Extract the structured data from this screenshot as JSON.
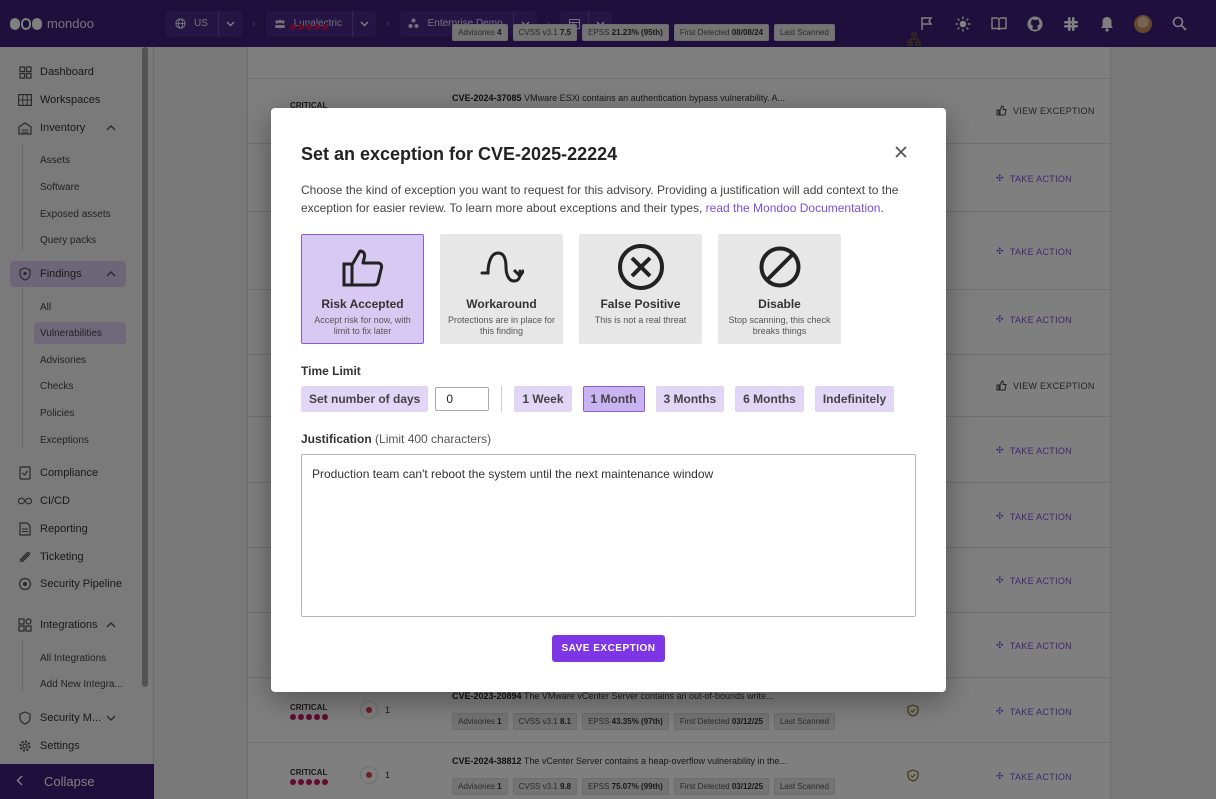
{
  "brand": {
    "name": "mondoo"
  },
  "topbar": {
    "region": "US",
    "org": "Lunalectric",
    "space": "Enterprise Demo",
    "workspace": "",
    "icons": [
      "flag-icon",
      "sun-icon",
      "book-icon",
      "github-icon",
      "slack-icon",
      "bell-icon",
      "avatar",
      "search-icon"
    ]
  },
  "sidebar": {
    "items": [
      {
        "label": "Dashboard",
        "icon": "dashboard-icon"
      },
      {
        "label": "Workspaces",
        "icon": "workspaces-icon"
      },
      {
        "label": "Inventory",
        "icon": "inventory-icon"
      },
      {
        "label": "Assets"
      },
      {
        "label": "Software"
      },
      {
        "label": "Exposed assets"
      },
      {
        "label": "Query packs"
      },
      {
        "label": "Findings",
        "icon": "shield-icon"
      },
      {
        "label": "All"
      },
      {
        "label": "Vulnerabilities"
      },
      {
        "label": "Advisories"
      },
      {
        "label": "Checks"
      },
      {
        "label": "Policies"
      },
      {
        "label": "Exceptions"
      },
      {
        "label": "Compliance",
        "icon": "compliance-icon"
      },
      {
        "label": "CI/CD",
        "icon": "infinity-icon"
      },
      {
        "label": "Reporting",
        "icon": "reporting-icon"
      },
      {
        "label": "Ticketing",
        "icon": "ticketing-icon"
      },
      {
        "label": "Security Pipeline",
        "icon": "pipeline-icon"
      },
      {
        "label": "Integrations",
        "icon": "integrations-icon"
      },
      {
        "label": "All Integrations"
      },
      {
        "label": "Add New Integra..."
      },
      {
        "label": "Security M...",
        "icon": "security-model-icon"
      },
      {
        "label": "Settings",
        "icon": "gear-icon"
      }
    ],
    "collapse_label": "Collapse"
  },
  "list": {
    "rows": [
      {
        "severity": "",
        "assets": "",
        "cve": "",
        "summary": "",
        "advisories": "4",
        "cvss": "7.5",
        "epss": "21.23% (95th)",
        "first_detected": "08/08/24",
        "last_scanned_label": "Last Scanned",
        "action": ""
      },
      {
        "severity": "CRITICAL",
        "assets": "",
        "cve": "CVE-2024-37085",
        "summary": "VMware ESXi contains an authentication bypass vulnerability. A...",
        "action": "VIEW EXCEPTION"
      },
      {
        "action": "TAKE ACTION"
      },
      {
        "action": "TAKE ACTION"
      },
      {
        "action": "TAKE ACTION"
      },
      {
        "action": "VIEW EXCEPTION"
      },
      {
        "action": "TAKE ACTION"
      },
      {
        "action": "TAKE ACTION"
      },
      {
        "action": "TAKE ACTION"
      },
      {
        "action": "TAKE ACTION"
      },
      {
        "severity": "CRITICAL",
        "assets": "1",
        "cve": "CVE-2023-20894",
        "summary": "The VMware vCenter Server contains an out-of-bounds write...",
        "advisories": "1",
        "cvss": "8.1",
        "epss": "43.35% (97th)",
        "first_detected": "03/12/25",
        "last_scanned_label": "Last Scanned",
        "action": "TAKE ACTION"
      },
      {
        "severity": "CRITICAL",
        "assets": "1",
        "cve": "CVE-2024-38812",
        "summary": "The vCenter Server contains a heap-overflow vulnerability in the...",
        "advisories": "1",
        "cvss": "9.8",
        "epss": "75.07% (99th)",
        "first_detected": "03/12/25",
        "last_scanned_label": "Last Scanned",
        "action": "TAKE ACTION"
      }
    ],
    "chip_labels": {
      "advisories": "Advisories",
      "cvss": "CVSS v3.1",
      "epss": "EPSS",
      "first_detected": "First Detected"
    }
  },
  "modal": {
    "title": "Set an exception for CVE-2025-22224",
    "description": "Choose the kind of exception you want to request for this advisory. Providing a justification will add context to the exception for easier review. To learn more about exceptions and their types, ",
    "doc_link": "read the Mondoo Documentation",
    "description_end": ".",
    "types": [
      {
        "name": "Risk Accepted",
        "desc": "Accept risk for now, with limit to fix later",
        "icon": "thumbs-up-icon",
        "selected": true
      },
      {
        "name": "Workaround",
        "desc": "Protections are in place for this finding",
        "icon": "workaround-icon",
        "selected": false
      },
      {
        "name": "False Positive",
        "desc": "This is not a real threat",
        "icon": "x-circle-icon",
        "selected": false
      },
      {
        "name": "Disable",
        "desc": "Stop scanning, this check breaks things",
        "icon": "disable-icon",
        "selected": false
      }
    ],
    "time_limit_label": "Time Limit",
    "set_days_label": "Set number of days",
    "days_value": "0",
    "time_options": [
      "1 Week",
      "1 Month",
      "3 Months",
      "6 Months",
      "Indefinitely"
    ],
    "selected_time": "1 Month",
    "justification_label": "Justification",
    "justification_limit": "(Limit 400 characters)",
    "justification_value": "Production team can't reboot the system until the next maintenance window",
    "save_label": "SAVE EXCEPTION"
  },
  "colors": {
    "brand": "#3d1f7a",
    "accent": "#7e35e6",
    "critical": "#c2185b"
  }
}
